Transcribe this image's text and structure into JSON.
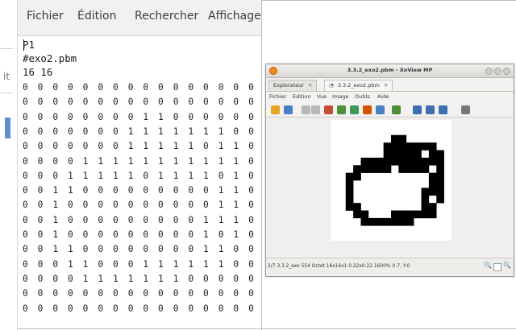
{
  "editor": {
    "menu": [
      "Fichier",
      "Édition",
      "Rechercher",
      "Affichage"
    ],
    "strip_fragment": "it",
    "header_lines": [
      "P1",
      "#exo2.pbm",
      "16 16"
    ],
    "rows": [
      "0 0 0 0 0 0 0 0 0 0 0 0 0 0 0 0",
      "0 0 0 0 0 0 0 0 0 0 0 0 0 0 0 0",
      "0 0 0 0 0 0 0 0 1 1 0 0 0 0 0 0",
      "0 0 0 0 0 0 0 1 1 1 1 1 1 1 0 0",
      "0 0 0 0 0 0 0 1 1 1 1 1 0 1 1 0",
      "0 0 0 0 1 1 1 1 1 1 1 1 1 1 1 0",
      "0 0 0 1 1 1 1 1 0 1 1 1 1 0 1 0",
      "0 0 1 1 0 0 0 0 0 0 0 0 0 1 1 0",
      "0 0 1 0 0 0 0 0 0 0 0 0 0 1 1 0",
      "0 0 1 0 0 0 0 0 0 0 0 0 1 1 1 0",
      "0 0 1 0 0 0 0 0 0 0 0 0 1 0 1 0",
      "0 0 1 1 0 0 0 0 0 0 0 0 1 1 0 0",
      "0 0 0 1 1 0 0 0 1 1 1 1 1 1 0 0",
      "0 0 0 0 1 1 1 1 1 1 1 0 0 0 0 0",
      "0 0 0 0 0 0 0 0 0 0 0 0 0 0 0 0",
      "0 0 0 0 0 0 0 0 0 0 0 0 0 0 0 0"
    ]
  },
  "xnview": {
    "title": "3.3.2_exo2.pbm - XnView MP",
    "tabs": [
      "Explorateur",
      "3.3.2_exo2.pbm"
    ],
    "menu": [
      "Fichier",
      "Edition",
      "Vue",
      "Image",
      "Outils",
      "Aide"
    ],
    "status": "2/7  3.3.2_exo  554 Octet  16x16x1  0.22x0.22  1600%  X:7, Y:0",
    "toolbar_icons": [
      "folder-icon",
      "save-icon",
      "undo-icon",
      "redo-icon",
      "gallery-icon",
      "image-icon",
      "refresh-icon",
      "color-icon",
      "monitor-icon",
      "view-icon",
      "zoom-in-icon",
      "zoom-fit-icon",
      "zoom-out-icon",
      "more-icon"
    ],
    "colors": {
      "title_icon": "#f08a1c",
      "pixel_on": "#000000",
      "pixel_off": "#ffffff"
    }
  }
}
